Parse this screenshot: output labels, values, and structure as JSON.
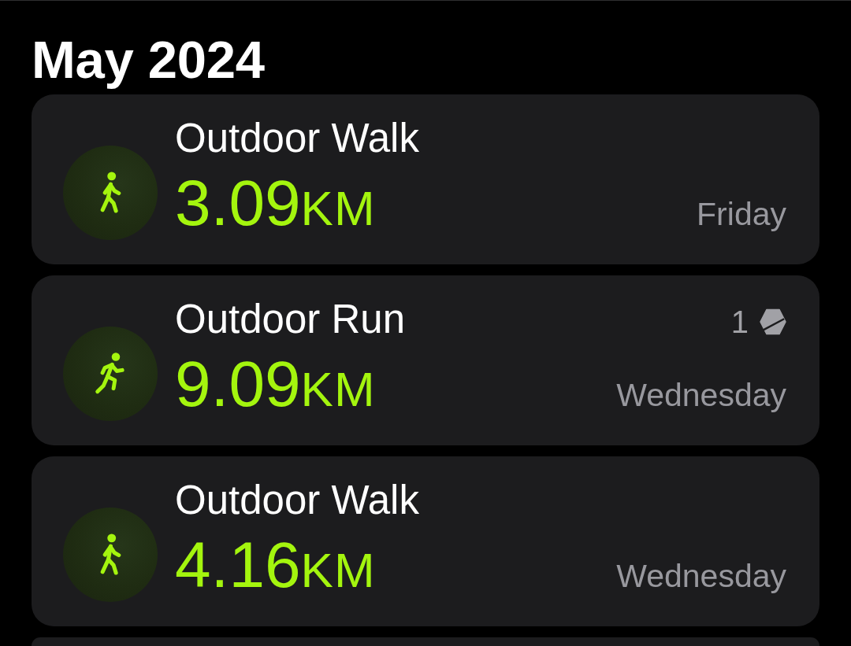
{
  "heading": "May 2024",
  "workouts": [
    {
      "kind": "walk",
      "title": "Outdoor Walk",
      "distance": "3.09",
      "unit": "KM",
      "day": "Friday"
    },
    {
      "kind": "run",
      "title": "Outdoor Run",
      "distance": "9.09",
      "unit": "KM",
      "day": "Wednesday",
      "awards": "1"
    },
    {
      "kind": "walk",
      "title": "Outdoor Walk",
      "distance": "4.16",
      "unit": "KM",
      "day": "Wednesday"
    }
  ]
}
